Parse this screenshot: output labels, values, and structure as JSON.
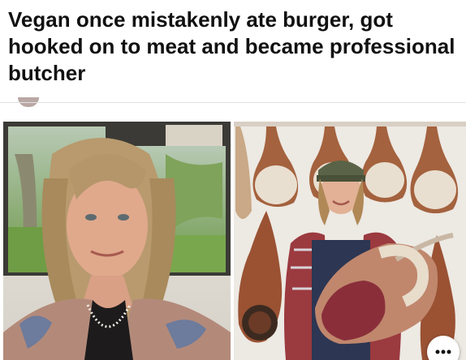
{
  "post": {
    "headline": "Vegan once mistakenly ate burger, got hooked on to meat and became professional butcher"
  },
  "images": [
    {
      "id": "left",
      "subject": "woman-selfie"
    },
    {
      "id": "right",
      "subject": "butcher-with-hams"
    }
  ],
  "colors": {
    "headline": "#111111",
    "divider": "#e2e2e2"
  }
}
